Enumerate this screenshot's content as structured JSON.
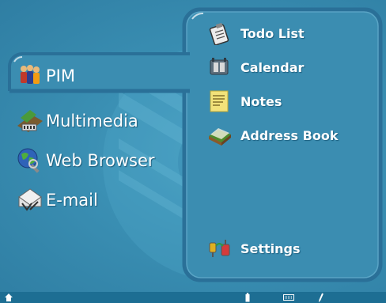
{
  "main_menu": {
    "items": [
      {
        "label": "PIM",
        "icon": "pim-icon",
        "selected": true
      },
      {
        "label": "Multimedia",
        "icon": "multimedia-icon"
      },
      {
        "label": "Web Browser",
        "icon": "web-browser-icon"
      },
      {
        "label": "E-mail",
        "icon": "email-icon"
      }
    ]
  },
  "submenu": {
    "items": [
      {
        "label": "Todo List",
        "icon": "clipboard-icon"
      },
      {
        "label": "Calendar",
        "icon": "calendar-icon"
      },
      {
        "label": "Notes",
        "icon": "sticky-note-icon"
      },
      {
        "label": "Address Book",
        "icon": "address-book-icon"
      }
    ],
    "settings": {
      "label": "Settings",
      "icon": "settings-icon"
    }
  },
  "taskbar": {
    "icons": [
      "home-icon",
      "battery-icon",
      "keyboard-icon",
      "pen-icon"
    ]
  },
  "colors": {
    "background": "#3a89ad",
    "panel": "#3b8db1",
    "panel_border": "#2a7098",
    "selected_highlight": "#296a8c",
    "taskbar": "#1d6e93",
    "text": "#ffffff"
  }
}
